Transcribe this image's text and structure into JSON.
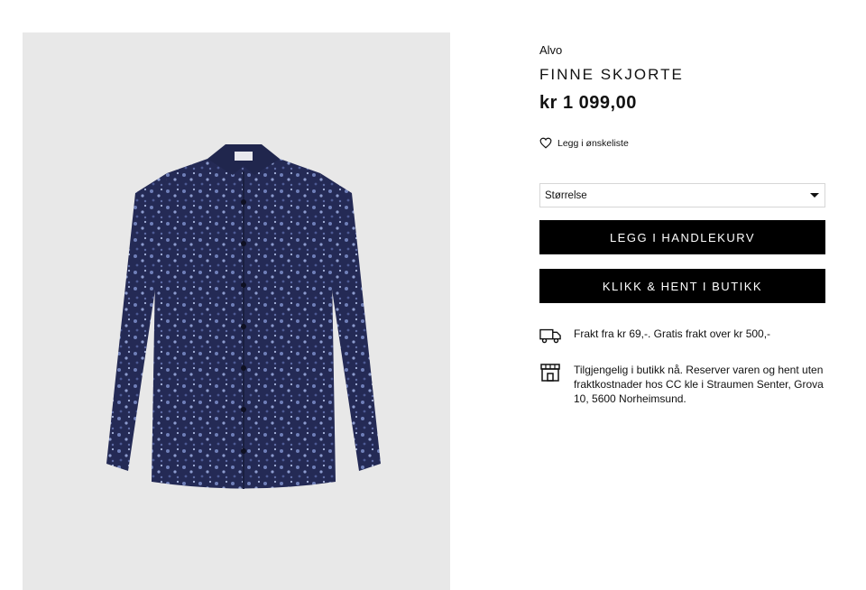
{
  "product": {
    "brand": "Alvo",
    "title": "FINNE SKJORTE",
    "price": "kr 1 099,00"
  },
  "wishlist": {
    "label": "Legg i ønskeliste",
    "icon": "heart-icon"
  },
  "size_select": {
    "placeholder": "Størrelse",
    "icon": "chevron-down-icon"
  },
  "buttons": {
    "add_to_cart": "LEGG I HANDLEKURV",
    "click_collect": "KLIKK & HENT I BUTIKK"
  },
  "info": {
    "shipping": {
      "icon": "truck-icon",
      "text": "Frakt fra kr 69,-. Gratis frakt over kr 500,-"
    },
    "store": {
      "icon": "store-icon",
      "text": "Tilgjengelig i butikk nå. Reserver varen og hent uten fraktkostnader hos CC kle i Straumen Senter, Grova 10, 5600 Norheimsund."
    }
  },
  "colors": {
    "image_bg": "#e8e8e8",
    "button_bg": "#000000",
    "shirt": "#23284f"
  }
}
